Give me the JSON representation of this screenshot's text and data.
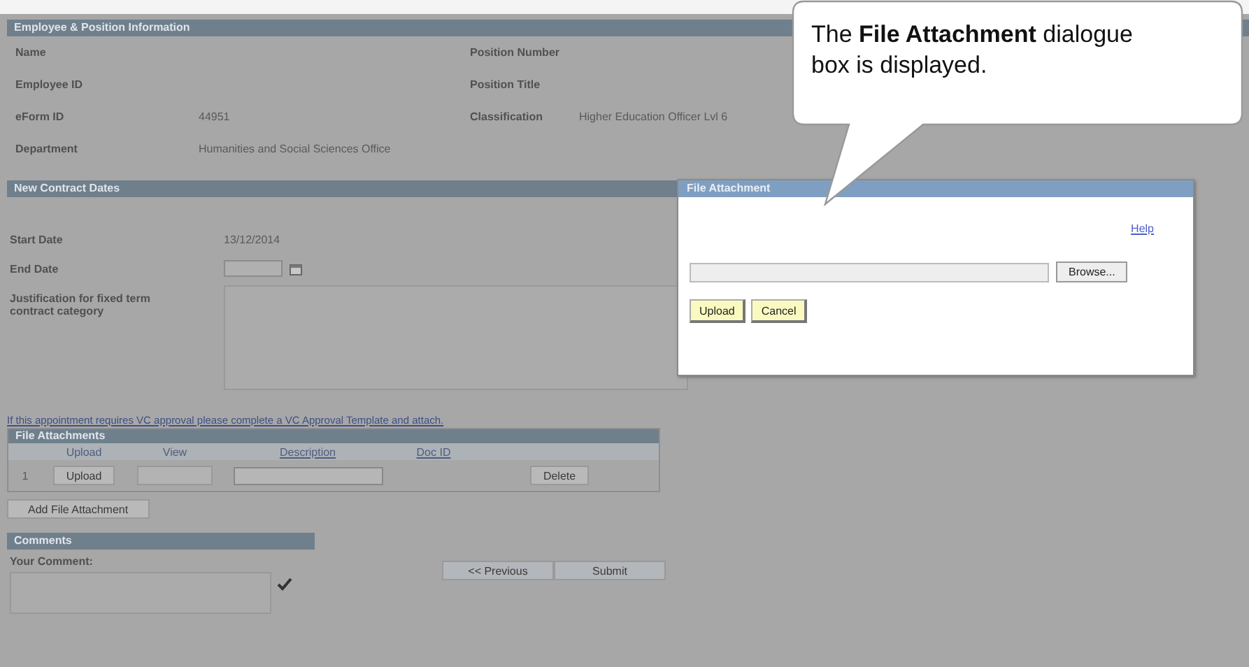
{
  "employee_section": {
    "title": "Employee & Position Information",
    "rows": [
      {
        "left_label": "Name",
        "right_label": "Position Number"
      },
      {
        "left_label": "Employee ID",
        "right_label": "Position Title"
      },
      {
        "left_label": "eForm ID",
        "left_value": "44951",
        "right_label": "Classification",
        "right_value": "Higher Education Officer Lvl 6"
      },
      {
        "left_label": "Department",
        "left_value": "Humanities and Social Sciences Office"
      }
    ]
  },
  "contract_section": {
    "title": "New Contract Dates",
    "start_date": {
      "label": "Start Date",
      "value": "13/12/2014"
    },
    "end_date": {
      "label": "End Date"
    },
    "justification": {
      "label": "Justification for fixed term contract category"
    }
  },
  "approval_link": "If this appointment requires VC approval please complete a VC Approval Template and attach.",
  "file_attachments": {
    "title": "File Attachments",
    "columns": [
      "Upload",
      "View",
      "Description",
      "Doc ID"
    ],
    "rows": [
      {
        "number": "1",
        "upload_button": "Upload",
        "delete_button": "Delete"
      }
    ],
    "add_button": "Add File Attachment"
  },
  "comments": {
    "title": "Comments",
    "label": "Your Comment:"
  },
  "buttons": [
    "<< Previous",
    "Submit"
  ],
  "dialog": {
    "title": "File Attachment",
    "help_link": "Help",
    "browse_button": "Browse...",
    "buttons": [
      "Upload",
      "Cancel"
    ]
  },
  "callout": {
    "text": "The **File Attachment** dialogue box is displayed."
  }
}
